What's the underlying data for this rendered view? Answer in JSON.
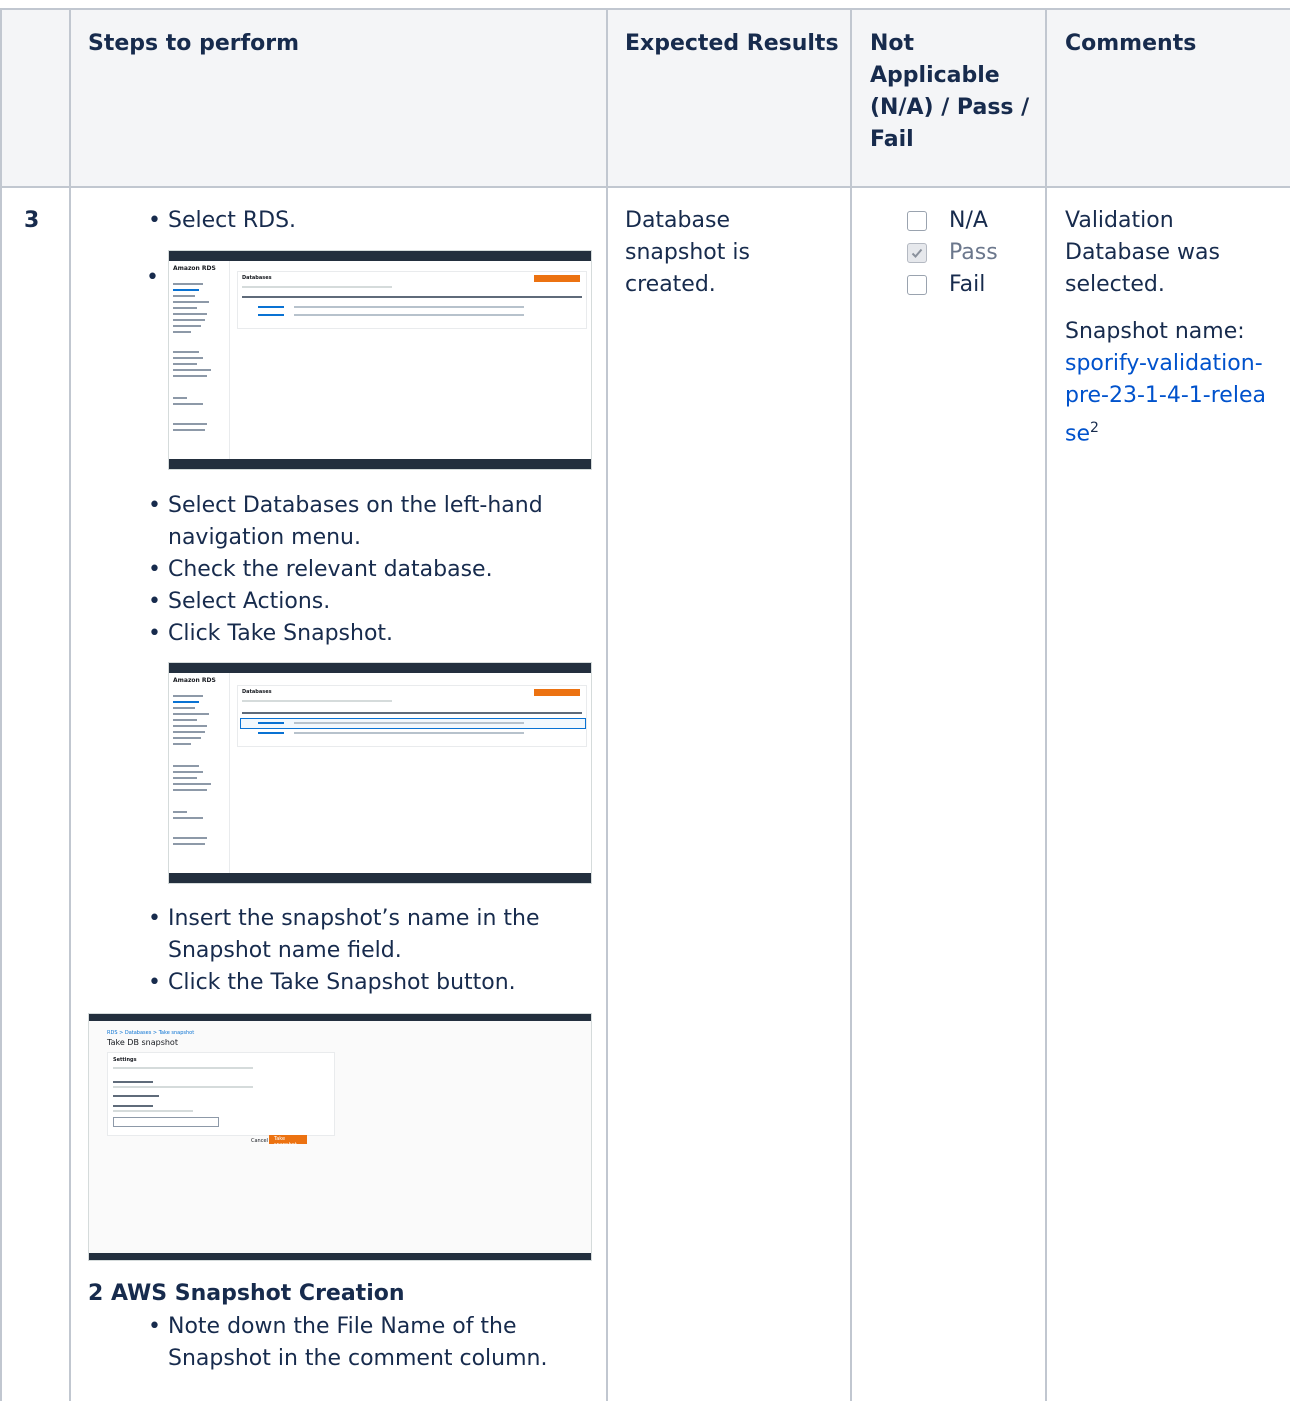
{
  "header": {
    "col_steps": "Steps to perform",
    "col_expected": "Expected Results",
    "col_status": "Not Applicable (N/A) / Pass / Fail",
    "col_comments": "Comments"
  },
  "row": {
    "number": "3",
    "steps_a": [
      "Select RDS."
    ],
    "steps_b": [
      "Select Databases on the left-hand navigation menu.",
      "Check the relevant database.",
      "Select Actions.",
      "Click Take Snapshot."
    ],
    "steps_c": [
      "Insert the snapshot’s name in the Snapshot name field.",
      "Click the Take Snapshot button."
    ],
    "figure_caption": "2 AWS Snapshot Creation",
    "steps_d": [
      "Note down the File Name of the Snapshot in the comment column."
    ],
    "expected": "Database snapshot is created.",
    "status_options": [
      {
        "label": "N/A",
        "checked": false
      },
      {
        "label": "Pass",
        "checked": true
      },
      {
        "label": "Fail",
        "checked": false
      }
    ],
    "comment_main": "Validation Database was selected.",
    "comment_name_label": "Snapshot name:",
    "comment_name_link": "sporify-validation-pre-23-1-4-1-release",
    "comment_footnote": "2"
  },
  "screenshots": {
    "rds_title": "Amazon RDS",
    "databases_panel": "Databases",
    "take_snapshot_title": "Take DB snapshot",
    "settings_label": "Settings",
    "take_snapshot_button": "Take snapshot",
    "cancel_button": "Cancel"
  }
}
